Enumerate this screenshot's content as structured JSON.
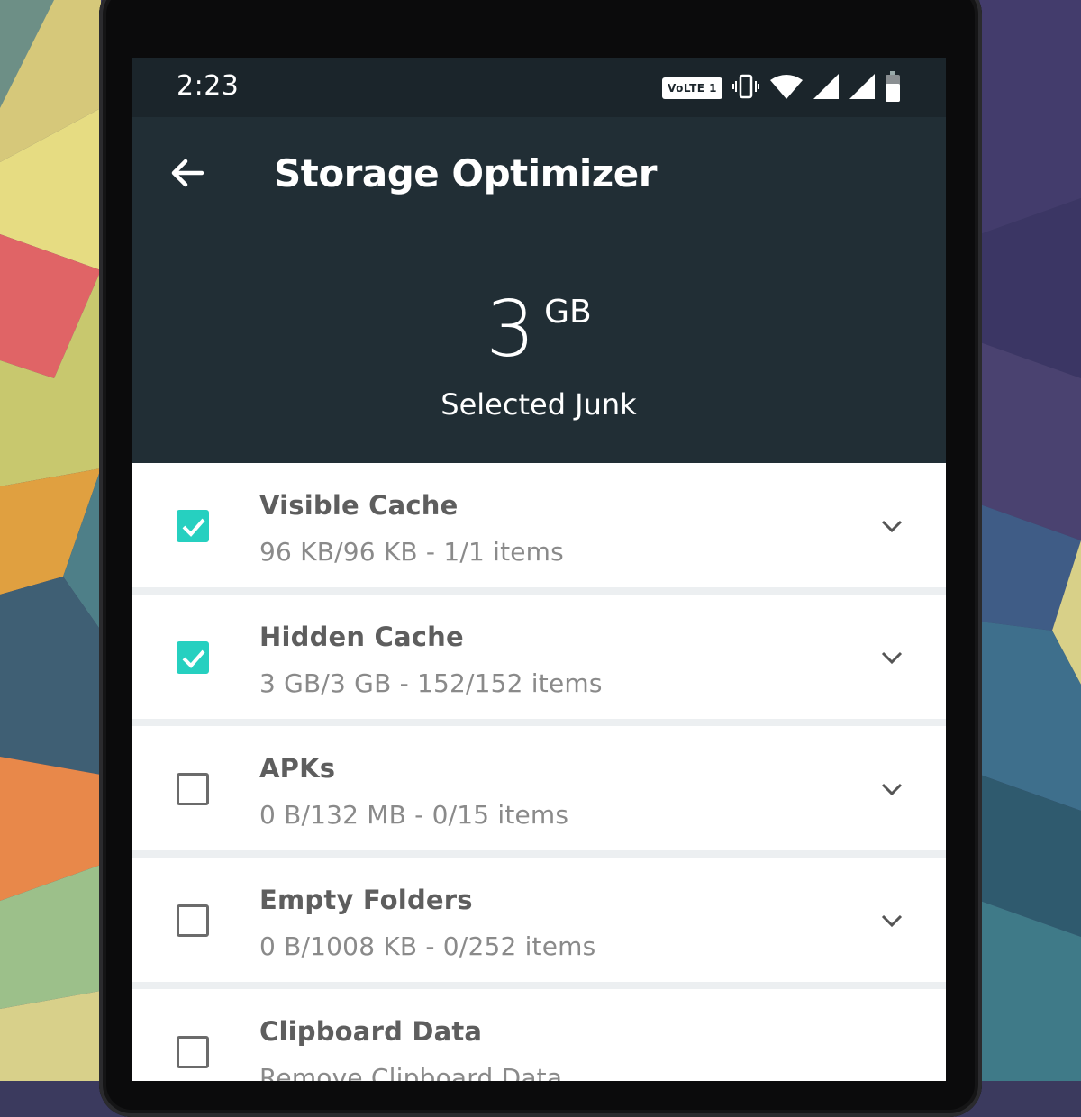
{
  "status_bar": {
    "time": "2:23",
    "volte_label": "VoLTE 1",
    "icons": [
      "vibrate-icon",
      "wifi-icon",
      "signal-icon",
      "signal-icon",
      "battery-icon"
    ]
  },
  "header": {
    "back_icon": "arrow-left-icon",
    "title": "Storage Optimizer",
    "junk_size_value": "3",
    "junk_size_unit": "GB",
    "junk_label": "Selected Junk"
  },
  "categories": [
    {
      "title": "Visible Cache",
      "detail": "96 KB/96 KB - 1/1 items",
      "checked": true
    },
    {
      "title": "Hidden Cache",
      "detail": "3 GB/3 GB - 152/152 items",
      "checked": true
    },
    {
      "title": "APKs",
      "detail": "0 B/132 MB - 0/15 items",
      "checked": false
    },
    {
      "title": "Empty Folders",
      "detail": "0 B/1008 KB - 0/252 items",
      "checked": false
    },
    {
      "title": "Clipboard Data",
      "detail": "Remove Clipboard Data",
      "checked": false
    }
  ],
  "colors": {
    "accent": "#26d0c0",
    "header_bg": "#212e35",
    "status_bg": "#1b252b"
  }
}
